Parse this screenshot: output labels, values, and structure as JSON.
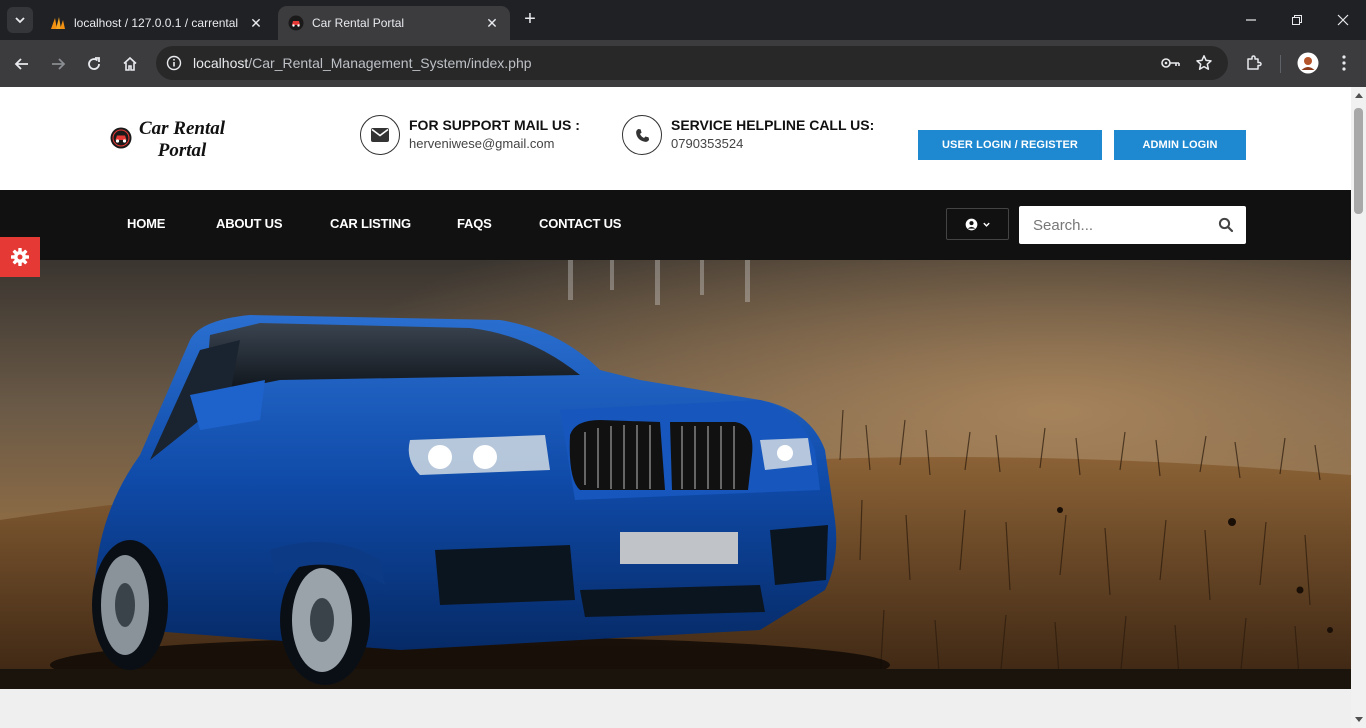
{
  "browser": {
    "tabs": [
      {
        "title": "localhost / 127.0.0.1 / carrental",
        "active": false
      },
      {
        "title": "Car Rental Portal",
        "active": true
      }
    ],
    "url_host": "localhost",
    "url_path": "/Car_Rental_Management_System/index.php"
  },
  "header": {
    "logo_line1": "Car Rental",
    "logo_line2": "Portal",
    "support_label": "FOR SUPPORT MAIL US :",
    "support_email": "herveniwese@gmail.com",
    "helpline_label": "SERVICE HELPLINE CALL US:",
    "helpline_phone": "0790353524",
    "user_login_button": "USER LOGIN / REGISTER",
    "admin_login_button": "ADMIN LOGIN"
  },
  "nav": {
    "items": [
      {
        "label": "HOME"
      },
      {
        "label": "ABOUT US"
      },
      {
        "label": "CAR LISTING"
      },
      {
        "label": "FAQS"
      },
      {
        "label": "CONTACT US"
      }
    ],
    "search_placeholder": "Search..."
  },
  "icons": {
    "settings": "gear-icon",
    "mail": "envelope-icon",
    "phone": "phone-icon",
    "user": "user-circle-icon",
    "search": "search-icon"
  },
  "colors": {
    "accent_button": "#1e88d0",
    "navbar": "#111111",
    "settings_tab": "#e53935"
  }
}
